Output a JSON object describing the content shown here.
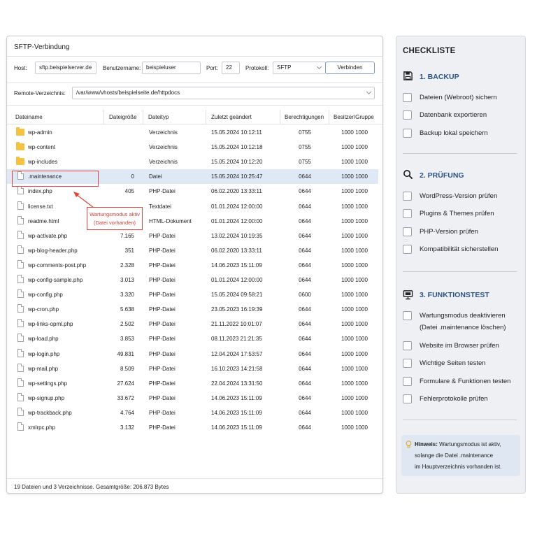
{
  "sftp": {
    "title": "SFTP-Verbindung",
    "host_label": "Host:",
    "host_value": "sftp.beispielserver.de",
    "user_label": "Benutzername:",
    "user_value": "beispieluser",
    "port_label": "Port:",
    "port_value": "22",
    "protocol_label": "Protokoll:",
    "protocol_value": "SFTP",
    "connect_label": "Verbinden",
    "remote_label": "Remote-Verzeichnis:",
    "remote_value": "/var/www/vhosts/beispielseite.de/httpdocs",
    "columns": [
      "Dateiname",
      "Dateigröße",
      "Dateityp",
      "Zuletzt geändert",
      "Berechtigungen",
      "Besitzer/Gruppe"
    ],
    "files": [
      {
        "icon": "folder-icon",
        "name": "wp-admin",
        "size": "",
        "type": "Verzeichnis",
        "modified": "15.05.2024 10:12:11",
        "perm": "0755",
        "owner": "1000 1000"
      },
      {
        "icon": "folder-icon",
        "name": "wp-content",
        "size": "",
        "type": "Verzeichnis",
        "modified": "15.05.2024 10:12:18",
        "perm": "0755",
        "owner": "1000 1000"
      },
      {
        "icon": "folder-icon",
        "name": "wp-includes",
        "size": "",
        "type": "Verzeichnis",
        "modified": "15.05.2024 10:12:20",
        "perm": "0755",
        "owner": "1000 1000"
      },
      {
        "icon": "file-icon",
        "name": ".maintenance",
        "size": "0",
        "type": "Datei",
        "modified": "15.05.2024 10:25:47",
        "perm": "0644",
        "owner": "1000 1000",
        "selected": true
      },
      {
        "icon": "file-icon",
        "name": "index.php",
        "size": "405",
        "type": "PHP-Datei",
        "modified": "06.02.2020 13:33:11",
        "perm": "0644",
        "owner": "1000 1000"
      },
      {
        "icon": "file-icon",
        "name": "license.txt",
        "size": "",
        "type": "Textdatei",
        "modified": "01.01.2024 12:00:00",
        "perm": "0644",
        "owner": "1000 1000"
      },
      {
        "icon": "file-icon",
        "name": "readme.html",
        "size": "",
        "type": "HTML-Dokument",
        "modified": "01.01.2024 12:00:00",
        "perm": "0644",
        "owner": "1000 1000"
      },
      {
        "icon": "file-icon",
        "name": "wp-activate.php",
        "size": "7.165",
        "type": "PHP-Datei",
        "modified": "13.02.2024 10:19:35",
        "perm": "0644",
        "owner": "1000 1000"
      },
      {
        "icon": "file-icon",
        "name": "wp-blog-header.php",
        "size": "351",
        "type": "PHP-Datei",
        "modified": "06.02.2020 13:33:11",
        "perm": "0644",
        "owner": "1000 1000"
      },
      {
        "icon": "file-icon",
        "name": "wp-comments-post.php",
        "size": "2.328",
        "type": "PHP-Datei",
        "modified": "14.06.2023 15:11:09",
        "perm": "0644",
        "owner": "1000 1000"
      },
      {
        "icon": "file-icon",
        "name": "wp-config-sample.php",
        "size": "3.013",
        "type": "PHP-Datei",
        "modified": "01.01.2024 12:00:00",
        "perm": "0644",
        "owner": "1000 1000"
      },
      {
        "icon": "file-icon",
        "name": "wp-config.php",
        "size": "3.320",
        "type": "PHP-Datei",
        "modified": "15.05.2024 09:58:21",
        "perm": "0600",
        "owner": "1000 1000"
      },
      {
        "icon": "file-icon",
        "name": "wp-cron.php",
        "size": "5.638",
        "type": "PHP-Datei",
        "modified": "23.05.2023 16:19:39",
        "perm": "0644",
        "owner": "1000 1000"
      },
      {
        "icon": "file-icon",
        "name": "wp-links-opml.php",
        "size": "2.502",
        "type": "PHP-Datei",
        "modified": "21.11.2022 10:01:07",
        "perm": "0644",
        "owner": "1000 1000"
      },
      {
        "icon": "file-icon",
        "name": "wp-load.php",
        "size": "3.853",
        "type": "PHP-Datei",
        "modified": "08.11.2023 21:21:35",
        "perm": "0644",
        "owner": "1000 1000"
      },
      {
        "icon": "file-icon",
        "name": "wp-login.php",
        "size": "49.831",
        "type": "PHP-Datei",
        "modified": "12.04.2024 17:53:57",
        "perm": "0644",
        "owner": "1000 1000"
      },
      {
        "icon": "file-icon",
        "name": "wp-mail.php",
        "size": "8.509",
        "type": "PHP-Datei",
        "modified": "16.10.2023 14:21:58",
        "perm": "0644",
        "owner": "1000 1000"
      },
      {
        "icon": "file-icon",
        "name": "wp-settings.php",
        "size": "27.624",
        "type": "PHP-Datei",
        "modified": "22.04.2024 13:31:50",
        "perm": "0644",
        "owner": "1000 1000"
      },
      {
        "icon": "file-icon",
        "name": "wp-signup.php",
        "size": "33.672",
        "type": "PHP-Datei",
        "modified": "14.06.2023 15:11:09",
        "perm": "0644",
        "owner": "1000 1000"
      },
      {
        "icon": "file-icon",
        "name": "wp-trackback.php",
        "size": "4.764",
        "type": "PHP-Datei",
        "modified": "14.06.2023 15:11:09",
        "perm": "0644",
        "owner": "1000 1000"
      },
      {
        "icon": "file-icon",
        "name": "xmlrpc.php",
        "size": "3.132",
        "type": "PHP-Datei",
        "modified": "14.06.2023 15:11:09",
        "perm": "0644",
        "owner": "1000 1000"
      }
    ],
    "callout_line1": "Wartungsmodus aktiv",
    "callout_line2": "(Datei vorhanden)",
    "status": "19 Dateien und 3 Verzeichnisse. Gesamtgröße: 206.873 Bytes"
  },
  "checklist": {
    "title": "CHECKLISTE",
    "sections": [
      {
        "icon": "save-icon",
        "title": "1. BACKUP",
        "items": [
          "Dateien (Webroot) sichern",
          "Datenbank exportieren",
          "Backup lokal speichern"
        ]
      },
      {
        "icon": "search-icon",
        "title": "2. PRÜFUNG",
        "items": [
          "WordPress-Version prüfen",
          "Plugins & Themes prüfen",
          "PHP-Version prüfen",
          "Kompatibilität sicherstellen"
        ]
      },
      {
        "icon": "monitor-icon",
        "title": "3. FUNKTIONSTEST",
        "items": [
          "Wartungsmodus deaktivieren",
          "Website im Browser prüfen",
          "Wichtige Seiten testen",
          "Formulare & Funktionen testen",
          "Fehlerprotokolle prüfen"
        ],
        "item0_line2": "(Datei .maintenance löschen)"
      }
    ],
    "hint_bold": "Hinweis:",
    "hint_line1": " Wartungsmodus ist aktiv,",
    "hint_line2": "solange die Datei .maintenance",
    "hint_line3": "im Hauptverzeichnis vorhanden ist.",
    "hint_icon": "lightbulb-icon",
    "accent_color": "#2e5486",
    "highlight_color": "#e1453d"
  }
}
